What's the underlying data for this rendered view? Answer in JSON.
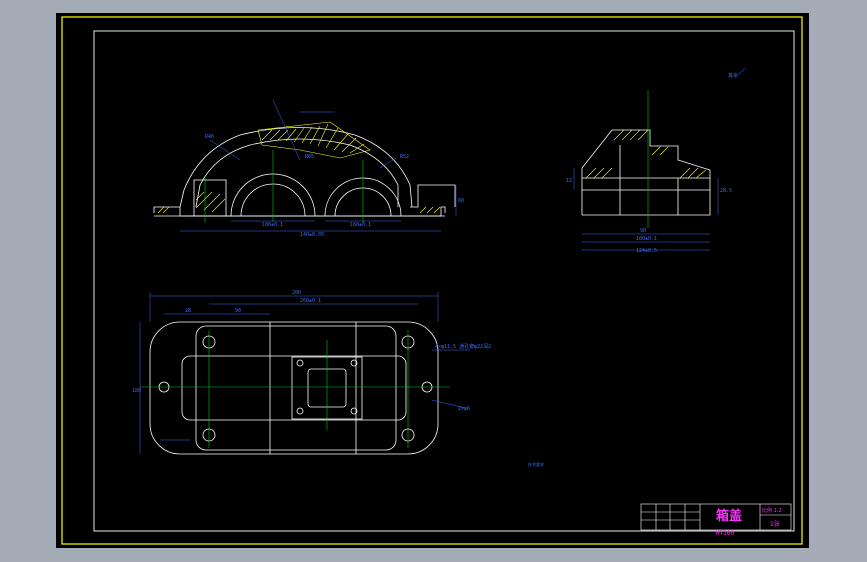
{
  "colors": {
    "app_background": "#a3acb7",
    "sheet": "#000000",
    "frame_outer": "#ffff00",
    "frame_inner": "#ffffff",
    "geometry": "#ffffff",
    "dimension": "#3b6bff",
    "centerline": "#00cc00",
    "hatch": "#ffff00",
    "title_text": "#ff33ff",
    "highlight": "#ff2020"
  },
  "front_view": {
    "dims": {
      "length_total": "140±0.05",
      "span_left": "180±0.1",
      "span_right": "160±0.1",
      "height": "60",
      "bore": "R46",
      "bore2": "R52",
      "radius": "R65"
    }
  },
  "side_view": {
    "dims": {
      "top_width": "90",
      "w1": "100±0.1",
      "w2": "124±0.5",
      "h1": "28.5",
      "h2": "12"
    }
  },
  "top_view": {
    "dims": {
      "overall": "280",
      "inner": "260±0.1",
      "left_off": "28",
      "mid": "90",
      "height": "180",
      "hole_note": "4×φ11.5 通孔锪φ22深2",
      "note2": "2×φ6"
    }
  },
  "tech_note": "技术要求",
  "title_block": {
    "part_name": "箱盖",
    "material": "HT200",
    "scale": "比例 1:2",
    "sheet_no": "1张"
  }
}
